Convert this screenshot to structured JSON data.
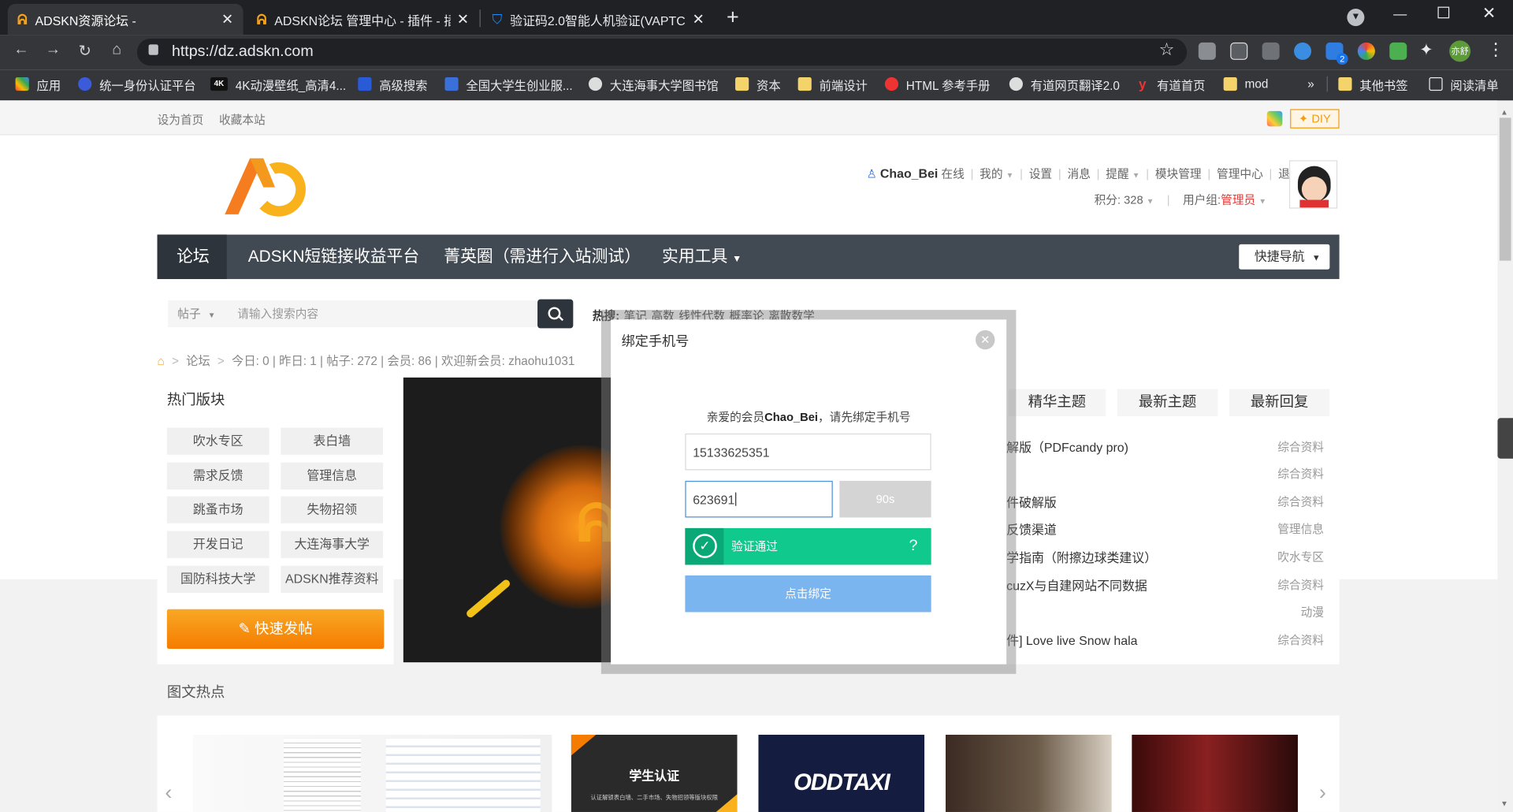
{
  "browser": {
    "tabs": [
      {
        "title": "ADSKN资源论坛 -",
        "active": true
      },
      {
        "title": "ADSKN论坛 管理中心 - 插件 - 插",
        "active": false
      },
      {
        "title": "验证码2.0智能人机验证(VAPTCHA)",
        "active": false
      }
    ],
    "new_tab": "+",
    "url": "https://dz.adskn.com",
    "bookmarks": [
      "应用",
      "统一身份认证平台",
      "4K动漫壁纸_高清4...",
      "高级搜索",
      "全国大学生创业服...",
      "大连海事大学图书馆",
      "资本",
      "前端设计",
      "HTML 参考手册",
      "有道网页翻译2.0",
      "有道首页",
      "mod"
    ],
    "bookmarks_more": "»",
    "bookmarks_right": [
      "其他书签",
      "阅读清单"
    ],
    "profile_name": "亦舒",
    "ext_badge": "2"
  },
  "site": {
    "top_links": [
      "设为首页",
      "收藏本站"
    ],
    "diy": "DIY",
    "user": {
      "name": "Chao_Bei",
      "status": "在线",
      "menu": [
        "我的",
        "设置",
        "消息",
        "提醒",
        "模块管理",
        "管理中心",
        "退出"
      ],
      "points": "积分: 328",
      "group_label": "用户组:",
      "group": "管理员"
    },
    "nav": [
      "论坛",
      "ADSKN短链接收益平台",
      "菁英圈（需进行入站测试）",
      "实用工具"
    ],
    "quick_nav": "快捷导航",
    "search": {
      "type": "帖子",
      "placeholder": "请输入搜索内容",
      "hot_label": "热搜:",
      "hot": [
        "笔记",
        "高数",
        "线性代数",
        "概率论",
        "离散数学"
      ]
    },
    "breadcrumb": {
      "forum": "论坛",
      "stats": "今日: 0 | 昨日: 1 | 帖子: 272 | 会员: 86 | 欢迎新会员: zhaohu1031"
    },
    "hot_boards": {
      "title": "热门版块",
      "items": [
        "吹水专区",
        "表白墙",
        "需求反馈",
        "管理信息",
        "跳蚤市场",
        "失物招领",
        "开发日记",
        "大连海事大学",
        "国防科技大学",
        "ADSKN推荐资料"
      ],
      "post_btn": "快速发帖"
    },
    "tabs": [
      "精华主题",
      "最新主题",
      "最新回复"
    ],
    "threads": [
      {
        "title": "解版（PDFcandy pro)",
        "cat": "综合资料"
      },
      {
        "title": "",
        "cat": "综合资料"
      },
      {
        "title": "件破解版",
        "cat": "综合资料"
      },
      {
        "title": "反馈渠道",
        "cat": "管理信息"
      },
      {
        "title": "学指南（附擦边球类建议）",
        "cat": "吹水专区"
      },
      {
        "title": "cuzX与自建网站不同数据",
        "cat": "综合资料"
      },
      {
        "title": "",
        "cat": "动漫"
      },
      {
        "title": "件] Love live Snow hala",
        "cat": "综合资料"
      }
    ],
    "image_hot": {
      "title": "图文热点",
      "student_card": "学生认证",
      "student_sub": "认证解锁表白墙、二手市场、失物招领等版块权限",
      "oddtaxi": "ODDTAXI"
    }
  },
  "modal": {
    "title": "绑定手机号",
    "prompt_pre": "亲爱的会员",
    "prompt_user": "Chao_Bei",
    "prompt_post": "，请先绑定手机号",
    "phone": "15133625351",
    "code": "623691",
    "countdown": "90s",
    "verify_text": "验证通过",
    "verify_help": "?",
    "bind_btn": "点击绑定"
  }
}
